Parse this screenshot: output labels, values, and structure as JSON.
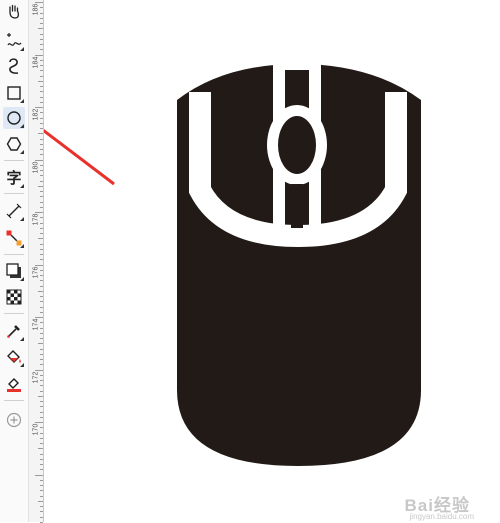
{
  "toolbox": {
    "tools": [
      {
        "name": "pan-tool",
        "icon": "hand-icon"
      },
      {
        "name": "freehand-tool",
        "icon": "freehand-icon"
      },
      {
        "name": "artistic-media-tool",
        "icon": "curve-icon"
      },
      {
        "name": "rectangle-tool",
        "icon": "rectangle-icon"
      },
      {
        "name": "ellipse-tool",
        "icon": "ellipse-icon",
        "selected": true
      },
      {
        "name": "polygon-tool",
        "icon": "polygon-icon"
      },
      {
        "name": "text-tool",
        "icon": "text-icon",
        "label": "字"
      },
      {
        "name": "parallel-dimension-tool",
        "icon": "dimension-icon"
      },
      {
        "name": "connector-tool",
        "icon": "connector-icon"
      },
      {
        "name": "drop-shadow-tool",
        "icon": "shadow-icon"
      },
      {
        "name": "transparency-tool",
        "icon": "checker-icon"
      },
      {
        "name": "eyedropper-tool",
        "icon": "eyedropper-icon"
      },
      {
        "name": "interactive-fill-tool",
        "icon": "fill-bucket-icon"
      },
      {
        "name": "smart-fill-tool",
        "icon": "smart-fill-icon"
      },
      {
        "name": "add-tool-button",
        "icon": "plus-circle-icon"
      }
    ]
  },
  "ruler": {
    "labels": [
      "186",
      "184",
      "182",
      "180",
      "178",
      "176",
      "174",
      "172",
      "170"
    ]
  },
  "annotation": {
    "color": "#e8312a",
    "points_to": "ellipse-tool"
  },
  "drawing": {
    "description_color": "#221a17"
  },
  "watermark": {
    "text": "Bai经验",
    "sub": "jingyan.baidu.com"
  },
  "colors": {
    "dark_fill": "#221a17",
    "accent_red": "#e8312a"
  }
}
